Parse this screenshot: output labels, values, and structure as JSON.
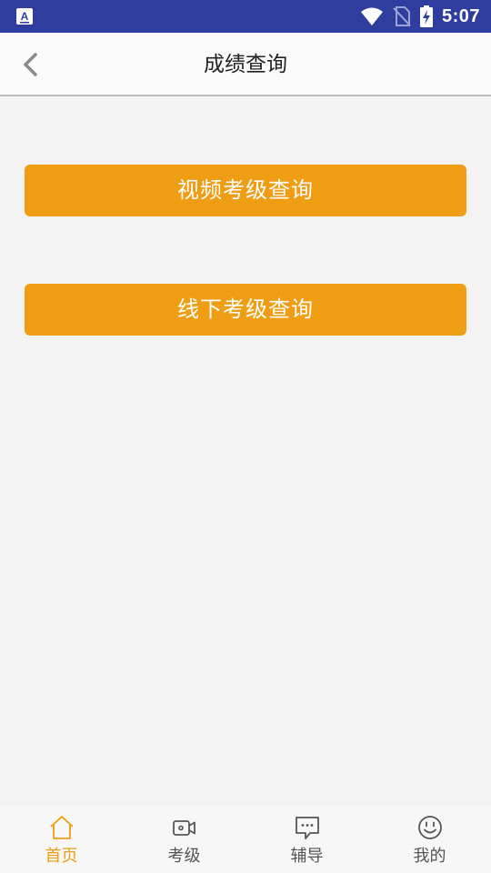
{
  "status_bar": {
    "time": "5:07",
    "icons": [
      "keyboard-a-icon",
      "wifi-icon",
      "no-sim-icon",
      "battery-charging-icon"
    ]
  },
  "header": {
    "title": "成绩查询",
    "back_icon": "chevron-left-icon"
  },
  "main": {
    "buttons": [
      {
        "label": "视频考级查询"
      },
      {
        "label": "线下考级查询"
      }
    ]
  },
  "tabs": [
    {
      "label": "首页",
      "icon": "home-icon",
      "active": true
    },
    {
      "label": "考级",
      "icon": "video-camera-icon",
      "active": false
    },
    {
      "label": "辅导",
      "icon": "chat-bubble-icon",
      "active": false
    },
    {
      "label": "我的",
      "icon": "smiley-face-icon",
      "active": false
    }
  ],
  "colors": {
    "status_bar": "#2f3e9e",
    "accent": "#ef9d12",
    "background": "#f3f3f3",
    "tab_inactive": "#555555"
  }
}
